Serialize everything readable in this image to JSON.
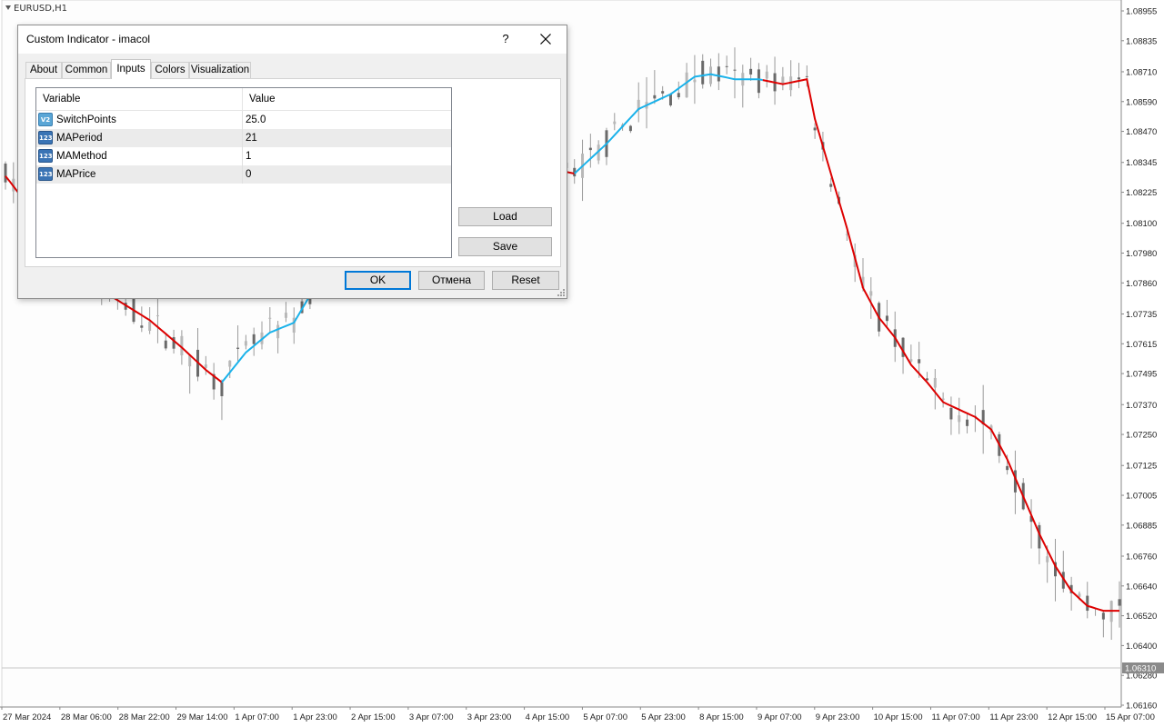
{
  "chart": {
    "symbol": "EURUSD,H1",
    "price_levels": [
      "1.08955",
      "1.08835",
      "1.08710",
      "1.08590",
      "1.08470",
      "1.08345",
      "1.08225",
      "1.08100",
      "1.07980",
      "1.07860",
      "1.07735",
      "1.07615",
      "1.07495",
      "1.07370",
      "1.07250",
      "1.07125",
      "1.07005",
      "1.06885",
      "1.06760",
      "1.06640",
      "1.06520",
      "1.06400",
      "1.06280",
      "1.06160"
    ],
    "current_price": "1.06310",
    "time_labels": [
      "27 Mar 2024",
      "28 Mar 06:00",
      "28 Mar 22:00",
      "29 Mar 14:00",
      "1 Apr 07:00",
      "1 Apr 23:00",
      "2 Apr 15:00",
      "3 Apr 07:00",
      "3 Apr 23:00",
      "4 Apr 15:00",
      "5 Apr 07:00",
      "5 Apr 23:00",
      "8 Apr 15:00",
      "9 Apr 07:00",
      "9 Apr 23:00",
      "10 Apr 15:00",
      "11 Apr 07:00",
      "11 Apr 23:00",
      "12 Apr 15:00",
      "15 Apr 07:00"
    ],
    "colors": {
      "up_trend": "#1ab2ea",
      "down_trend": "#dd0000",
      "candle": "#707070",
      "axis": "#222222"
    },
    "ma_line": {
      "note_units": "price vs time index",
      "points": [
        {
          "t": 0,
          "p": 1.0829
        },
        {
          "t": 0.5,
          "p": 1.0827
        },
        {
          "t": 10,
          "p": 1.0787
        },
        {
          "t": 18,
          "p": 1.0771
        },
        {
          "t": 22,
          "p": 1.076
        },
        {
          "t": 25,
          "p": 1.0751
        },
        {
          "t": 27,
          "p": 1.0746
        },
        {
          "t": 30,
          "p": 1.0758
        },
        {
          "t": 33,
          "p": 1.0766
        },
        {
          "t": 36,
          "p": 1.077
        },
        {
          "t": 38,
          "p": 1.0781
        },
        {
          "t": 40,
          "p": 1.0797
        },
        {
          "t": 44,
          "p": 1.0812
        },
        {
          "t": 48,
          "p": 1.083
        },
        {
          "t": 50,
          "p": 1.0842
        },
        {
          "t": 52,
          "p": 1.0838
        },
        {
          "t": 54,
          "p": 1.0837
        },
        {
          "t": 57,
          "p": 1.0832
        },
        {
          "t": 60,
          "p": 1.0833
        },
        {
          "t": 63,
          "p": 1.0832
        },
        {
          "t": 66,
          "p": 1.0833
        },
        {
          "t": 68,
          "p": 1.0832
        },
        {
          "t": 71,
          "p": 1.083
        },
        {
          "t": 75,
          "p": 1.0842
        },
        {
          "t": 79,
          "p": 1.0856
        },
        {
          "t": 83,
          "p": 1.0862
        },
        {
          "t": 86,
          "p": 1.0869
        },
        {
          "t": 88,
          "p": 1.087
        },
        {
          "t": 91,
          "p": 1.0868
        },
        {
          "t": 94,
          "p": 1.0868
        },
        {
          "t": 97,
          "p": 1.0866
        },
        {
          "t": 100,
          "p": 1.0868
        },
        {
          "t": 101,
          "p": 1.0852
        },
        {
          "t": 103,
          "p": 1.083
        },
        {
          "t": 105,
          "p": 1.0808
        },
        {
          "t": 107,
          "p": 1.0784
        },
        {
          "t": 109,
          "p": 1.0772
        },
        {
          "t": 111,
          "p": 1.0764
        },
        {
          "t": 113,
          "p": 1.0753
        },
        {
          "t": 115,
          "p": 1.0746
        },
        {
          "t": 117,
          "p": 1.0738
        },
        {
          "t": 119,
          "p": 1.0735
        },
        {
          "t": 121,
          "p": 1.0732
        },
        {
          "t": 123,
          "p": 1.0727
        },
        {
          "t": 125,
          "p": 1.0715
        },
        {
          "t": 127,
          "p": 1.07
        },
        {
          "t": 129,
          "p": 1.0685
        },
        {
          "t": 131,
          "p": 1.0672
        },
        {
          "t": 133,
          "p": 1.0662
        },
        {
          "t": 135,
          "p": 1.0656
        },
        {
          "t": 137,
          "p": 1.0654
        },
        {
          "t": 139,
          "p": 1.0654
        }
      ],
      "up_segments": [
        [
          27,
          48
        ],
        [
          60,
          63
        ],
        [
          71,
          94
        ]
      ]
    }
  },
  "dialog": {
    "title": "Custom Indicator - imacol",
    "help": "?",
    "tabs": [
      "About",
      "Common",
      "Inputs",
      "Colors",
      "Visualization"
    ],
    "active_tab": "Inputs",
    "columns": [
      "Variable",
      "Value"
    ],
    "rows": [
      {
        "icon": "double-type-icon",
        "icon_text": "V2",
        "name": "SwitchPoints",
        "value": "25.0"
      },
      {
        "icon": "int-type-icon",
        "icon_text": "123",
        "name": "MAPeriod",
        "value": "21"
      },
      {
        "icon": "int-type-icon",
        "icon_text": "123",
        "name": "MAMethod",
        "value": "1"
      },
      {
        "icon": "int-type-icon",
        "icon_text": "123",
        "name": "MAPrice",
        "value": "0"
      }
    ],
    "buttons": {
      "load": "Load",
      "save": "Save",
      "ok": "OK",
      "cancel": "Отмена",
      "reset": "Reset"
    }
  }
}
